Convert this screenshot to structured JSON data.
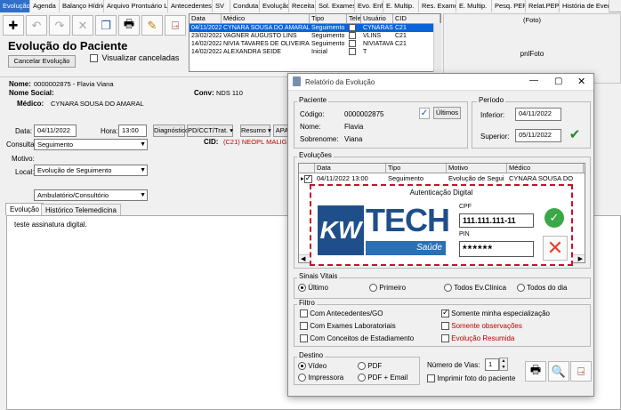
{
  "tabs": [
    "Evolução",
    "Agenda",
    "Balanço Hídrico",
    "Arquivo Prontuário L",
    "Antecedentes",
    "SV",
    "Conduta",
    "Evolução",
    "Receita",
    "Sol. Exames",
    "Evo. Enf.",
    "E. Multip.",
    "Res. Exames",
    "E. Multip.",
    "Pesq. PEP",
    "Relat.PEP",
    "História de Eventos"
  ],
  "page_title": "Evolução do Paciente",
  "cancel_button": "Cancelar Evolução",
  "show_canceled": "Visualizar canceladas",
  "foto": {
    "caption": "(Foto)",
    "name": "pnlFoto"
  },
  "evo_grid": {
    "headers": [
      "Data",
      "Médico",
      "Tipo",
      "Tele",
      "Usuário",
      "CID"
    ],
    "rows": [
      {
        "data": "04/11/2022",
        "medico": "CYNARA SOUSA DO AMARAL",
        "tipo": "Seguimento",
        "usuario": "CYNARASOUSA",
        "cid": "C21",
        "selected": true
      },
      {
        "data": "23/02/2022",
        "medico": "VAGNER AUGUSTO LINS",
        "tipo": "Seguimento",
        "usuario": "VLINS",
        "cid": "C21",
        "selected": false
      },
      {
        "data": "14/02/2022",
        "medico": "NIVIA TAVARES DE OLIVEIRA SO",
        "tipo": "Seguimento",
        "usuario": "NIVIATAVARES",
        "cid": "C21",
        "selected": false
      },
      {
        "data": "14/02/2022",
        "medico": "ALEXANDRA SEIDE",
        "tipo": "Inicial",
        "usuario": "T",
        "cid": "",
        "selected": false
      }
    ]
  },
  "patient": {
    "nome_label": "Nome:",
    "nome_value": "0000002875 - Flavia Viana",
    "social_label": "Nome Social:",
    "conv_label": "Conv:",
    "conv_value": "NDS 110",
    "medico_label": "Médico:",
    "medico_value": "CYNARA SOUSA DO AMARAL"
  },
  "form": {
    "data_label": "Data:",
    "data_value": "04/11/2022",
    "hora_label": "Hora:",
    "hora_value": "13:00",
    "consulta_label": "Consulta:",
    "consulta_value": "Seguimento",
    "motivo_label": "Motivo:",
    "motivo_value": "Evolução de Seguimento",
    "local_label": "Local:",
    "local_value": "Ambulatório/Consultório"
  },
  "mid_buttons": [
    "Diagnóstico",
    "PD/CCT/Trat.",
    "Resumo",
    "APA"
  ],
  "cid_label": "CID:",
  "cid_value": "(C21) NEOPL MALIG DO ANU",
  "bottom_tabs": [
    "Evolução",
    "Histórico Telemedicina"
  ],
  "evolution_text": "teste assinatura digital.",
  "dialog": {
    "title": "Relatório da Evolução",
    "paciente_group": "Paciente",
    "codigo_label": "Código:",
    "codigo_value": "0000002875",
    "nome_label": "Nome:",
    "nome_value": "Flavia",
    "sobrenome_label": "Sobrenome:",
    "sobrenome_value": "Viana",
    "ultimos_button": "Últimos",
    "periodo_group": "Período",
    "inferior_label": "Inferior:",
    "inferior_value": "04/11/2022",
    "superior_label": "Superior:",
    "superior_value": "05/11/2022",
    "evolucoes_group": "Evoluções",
    "evo_headers": [
      "Data",
      "Tipo",
      "Motivo",
      "Médico"
    ],
    "evo_row": {
      "data": "04/11/2022 13:00",
      "tipo": "Seguimento",
      "motivo": "Evolução de Segui",
      "medico": "CYNARA SOUSA DO"
    },
    "sinais_group": "Sinais Vitais",
    "sinais_options": [
      "Último",
      "Primeiro",
      "Todos Ev.Clínica",
      "Todos do dia"
    ],
    "filtro_group": "Filtro",
    "filtro_left": [
      "Com Antecedentes/GO",
      "Com Exames Laboratoriais",
      "Com Conceitos de Estadiamento"
    ],
    "filtro_right": [
      "Somente minha especialização",
      "Somente observações",
      "Evolução Resumida"
    ],
    "destino_group": "Destino",
    "destino_options": [
      "Vídeo",
      "PDF",
      "Impressora",
      "PDF + Email"
    ],
    "vias_label": "Número de Vias:",
    "vias_value": "1",
    "imprimir_foto": "Imprimir foto do paciente"
  },
  "auth": {
    "title": "Autenticação Digital",
    "logo_text": "TECH",
    "logo_sub": "Saúde",
    "cpf_label": "CPF",
    "cpf_value": "111.111.111-11",
    "pin_label": "PIN",
    "pin_value": "******"
  },
  "colors": {
    "accent": "#0a64d8",
    "auth_border": "#c8102e",
    "cid_text": "#c00000",
    "logo_blue": "#1f4f8a"
  }
}
